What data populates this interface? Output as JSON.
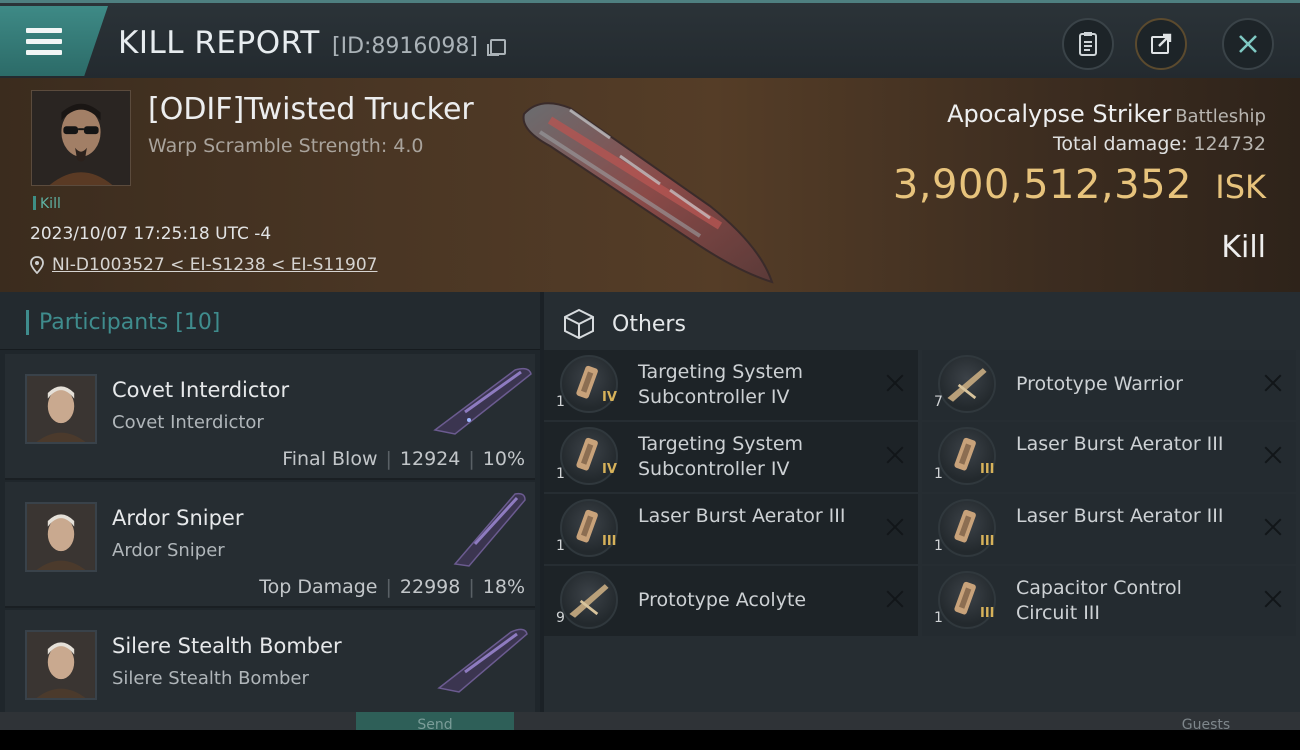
{
  "header": {
    "title": "KILL REPORT",
    "report_id": "[ID:8916098]",
    "icons": [
      "menu-icon",
      "copy-icon",
      "clipboard-icon",
      "share-icon",
      "close-icon"
    ]
  },
  "victim": {
    "name": "[ODIF]Twisted Trucker",
    "warp_scramble": "Warp Scramble Strength: 4.0",
    "tag": "Kill",
    "timestamp": "2023/10/07 17:25:18 UTC -4",
    "location": "NI-D1003527 < EI-S1238 < EI-S11907",
    "ship_name": "Apocalypse Striker",
    "ship_class": "Battleship",
    "total_damage_label": "Total damage:",
    "total_damage": "124732",
    "isk_value": "3,900,512,352",
    "isk_unit": "ISK",
    "result": "Kill"
  },
  "participants": {
    "title": "Participants",
    "count": "[10]",
    "rows": [
      {
        "name": "Covet Interdictor",
        "ship": "Covet Interdictor",
        "tag": "Final Blow",
        "damage": "12924",
        "percent": "10%"
      },
      {
        "name": "Ardor Sniper",
        "ship": "Ardor Sniper",
        "tag": "Top Damage",
        "damage": "22998",
        "percent": "18%"
      },
      {
        "name": "Silere Stealth Bomber",
        "ship": "Silere Stealth Bomber",
        "tag": "",
        "damage": "",
        "percent": ""
      }
    ]
  },
  "others": {
    "title": "Others",
    "items": [
      {
        "name": "Targeting System Subcontroller IV",
        "qty": "1",
        "tier": "IV"
      },
      {
        "name": "Prototype  Warrior",
        "qty": "7",
        "tier": ""
      },
      {
        "name": "Targeting System Subcontroller IV",
        "qty": "1",
        "tier": "IV"
      },
      {
        "name": "Laser Burst Aerator III",
        "qty": "1",
        "tier": "III"
      },
      {
        "name": "Laser Burst Aerator III",
        "qty": "1",
        "tier": "III"
      },
      {
        "name": "Laser Burst Aerator III",
        "qty": "1",
        "tier": "III"
      },
      {
        "name": "Prototype  Acolyte",
        "qty": "9",
        "tier": ""
      },
      {
        "name": "Capacitor Control Circuit III",
        "qty": "1",
        "tier": "III"
      }
    ]
  },
  "footer": {
    "send_label": "Send",
    "guests_label": "Guests"
  },
  "colors": {
    "accent": "#3f8c8d",
    "isk": "#e7c37c",
    "tier": "#d7b25a"
  }
}
